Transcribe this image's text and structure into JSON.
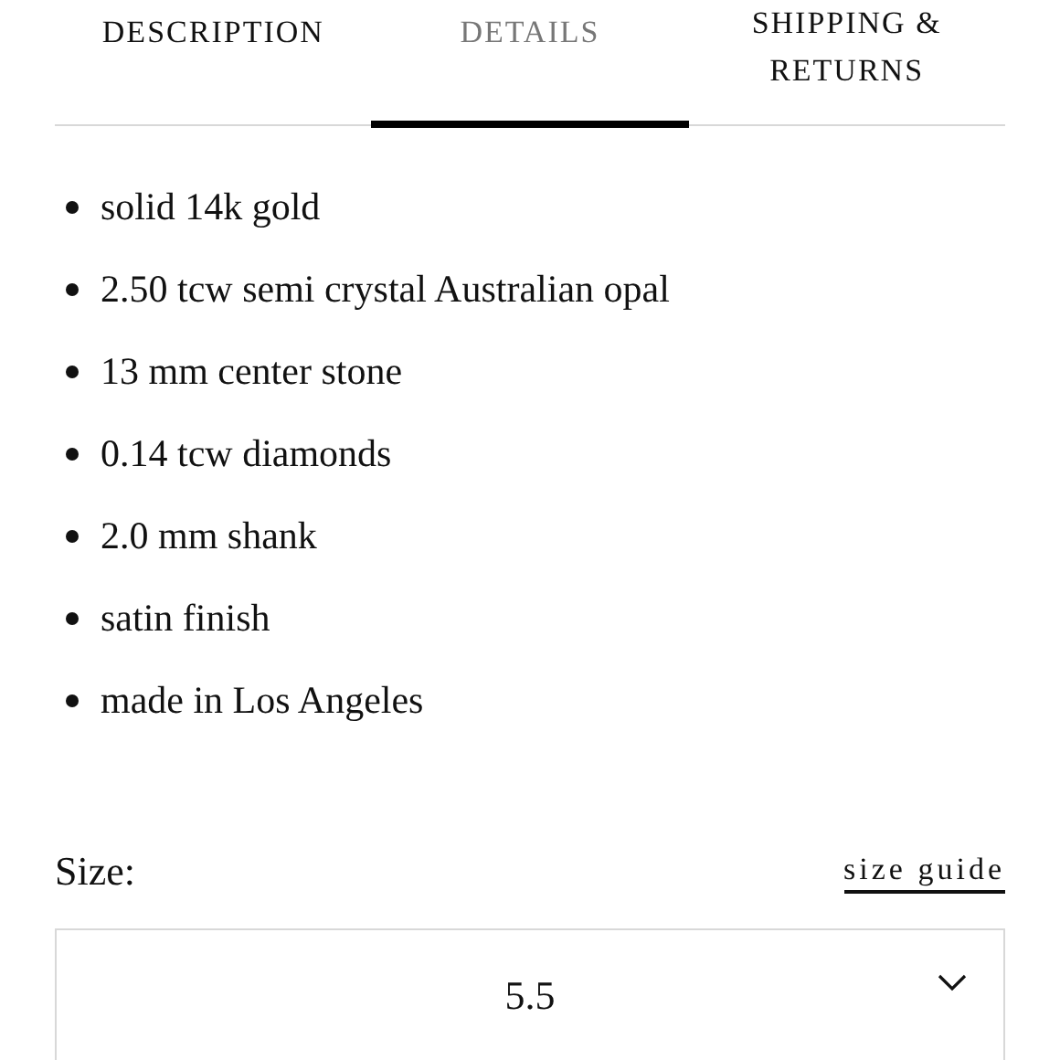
{
  "tabs": [
    {
      "label": "DESCRIPTION",
      "selected": false
    },
    {
      "label": "DETAILS",
      "selected": true
    },
    {
      "label": "SHIPPING & RETURNS",
      "selected": false
    }
  ],
  "details": [
    "solid 14k gold",
    "2.50 tcw semi crystal Australian opal",
    "13 mm center stone",
    "0.14 tcw diamonds",
    "2.0 mm shank",
    "satin finish",
    "made in Los Angeles"
  ],
  "size": {
    "label": "Size:",
    "guide_link": "size guide",
    "value": "5.5"
  }
}
